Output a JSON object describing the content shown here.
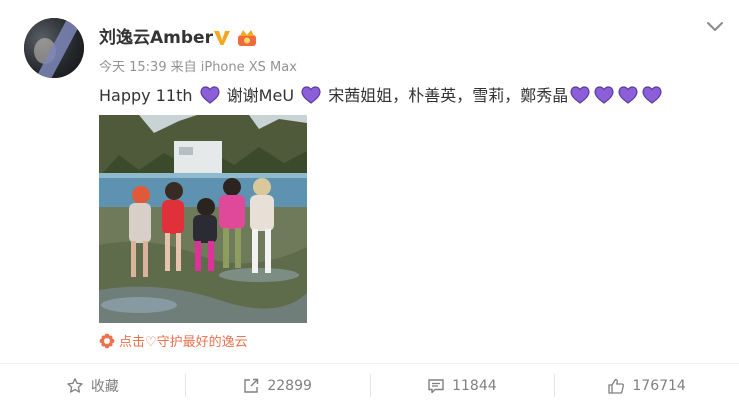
{
  "user": {
    "name": "刘逸云Amber"
  },
  "meta": {
    "time": "今天 15:39",
    "source": "来自 iPhone XS Max"
  },
  "post": {
    "part1": "Happy 11th",
    "part2": "谢谢MeU",
    "part3": "宋茜姐姐，朴善英，雪莉，鄭秀晶",
    "heart_color": "#8c5fd8"
  },
  "tip": {
    "text": "点击♡守护最好的逸云"
  },
  "actions": {
    "favorite": "收藏",
    "repost": "22899",
    "comment": "11844",
    "like": "176714"
  },
  "colors": {
    "accent_orange": "#eb7350",
    "vip_badge": "#f5a623",
    "meta_gray": "#939393"
  }
}
